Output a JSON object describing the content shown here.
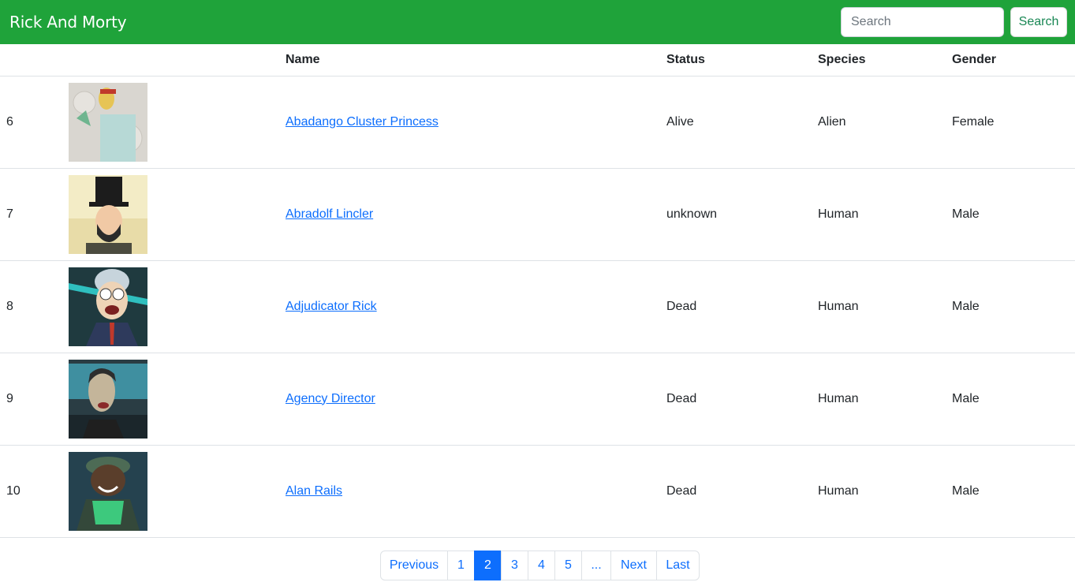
{
  "navbar": {
    "brand": "Rick And Morty",
    "search_placeholder": "Search",
    "search_button": "Search",
    "color": "#1fa33a"
  },
  "table": {
    "headers": [
      "",
      "",
      "Name",
      "Status",
      "Species",
      "Gender"
    ],
    "rows": [
      {
        "id": "6",
        "name": "Abadango Cluster Princess",
        "status": "Alive",
        "species": "Alien",
        "gender": "Female"
      },
      {
        "id": "7",
        "name": "Abradolf Lincler",
        "status": "unknown",
        "species": "Human",
        "gender": "Male"
      },
      {
        "id": "8",
        "name": "Adjudicator Rick",
        "status": "Dead",
        "species": "Human",
        "gender": "Male"
      },
      {
        "id": "9",
        "name": "Agency Director",
        "status": "Dead",
        "species": "Human",
        "gender": "Male"
      },
      {
        "id": "10",
        "name": "Alan Rails",
        "status": "Dead",
        "species": "Human",
        "gender": "Male"
      }
    ]
  },
  "pagination": {
    "previous": "Previous",
    "pages": [
      "1",
      "2",
      "3",
      "4",
      "5",
      "..."
    ],
    "active": "2",
    "next": "Next",
    "last": "Last",
    "accent": "#0d6efd"
  }
}
